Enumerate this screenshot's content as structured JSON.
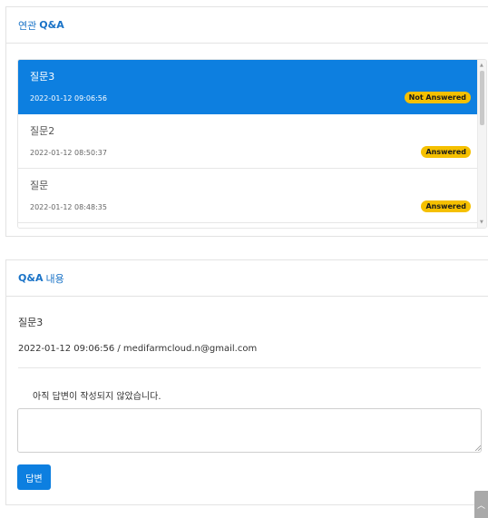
{
  "related": {
    "header_prefix": "연관",
    "header_main": "Q&A",
    "items": [
      {
        "title": "질문3",
        "date": "2022-01-12 09:06:56",
        "status": "Not Answered"
      },
      {
        "title": "질문2",
        "date": "2022-01-12 08:50:37",
        "status": "Answered"
      },
      {
        "title": "질문",
        "date": "2022-01-12 08:48:35",
        "status": "Answered"
      }
    ],
    "active_index": 0
  },
  "content": {
    "header_main": "Q&A",
    "header_suffix": "내용",
    "title": "질문3",
    "meta": "2022-01-12 09:06:56 / medifarmcloud.n@gmail.com",
    "answer_text": "아직 답변이 작성되지 않았습니다.",
    "answer_input_value": "",
    "submit_label": "답변"
  },
  "colors": {
    "accent": "#0d7fe0",
    "badge": "#f5c000",
    "header_text": "#1a73c7"
  },
  "icons": {
    "scroll_up": "scroll-up-arrow-icon",
    "scroll_down": "scroll-down-arrow-icon",
    "back_to_top": "chevron-up-icon",
    "resize": "resize-grip-icon"
  }
}
